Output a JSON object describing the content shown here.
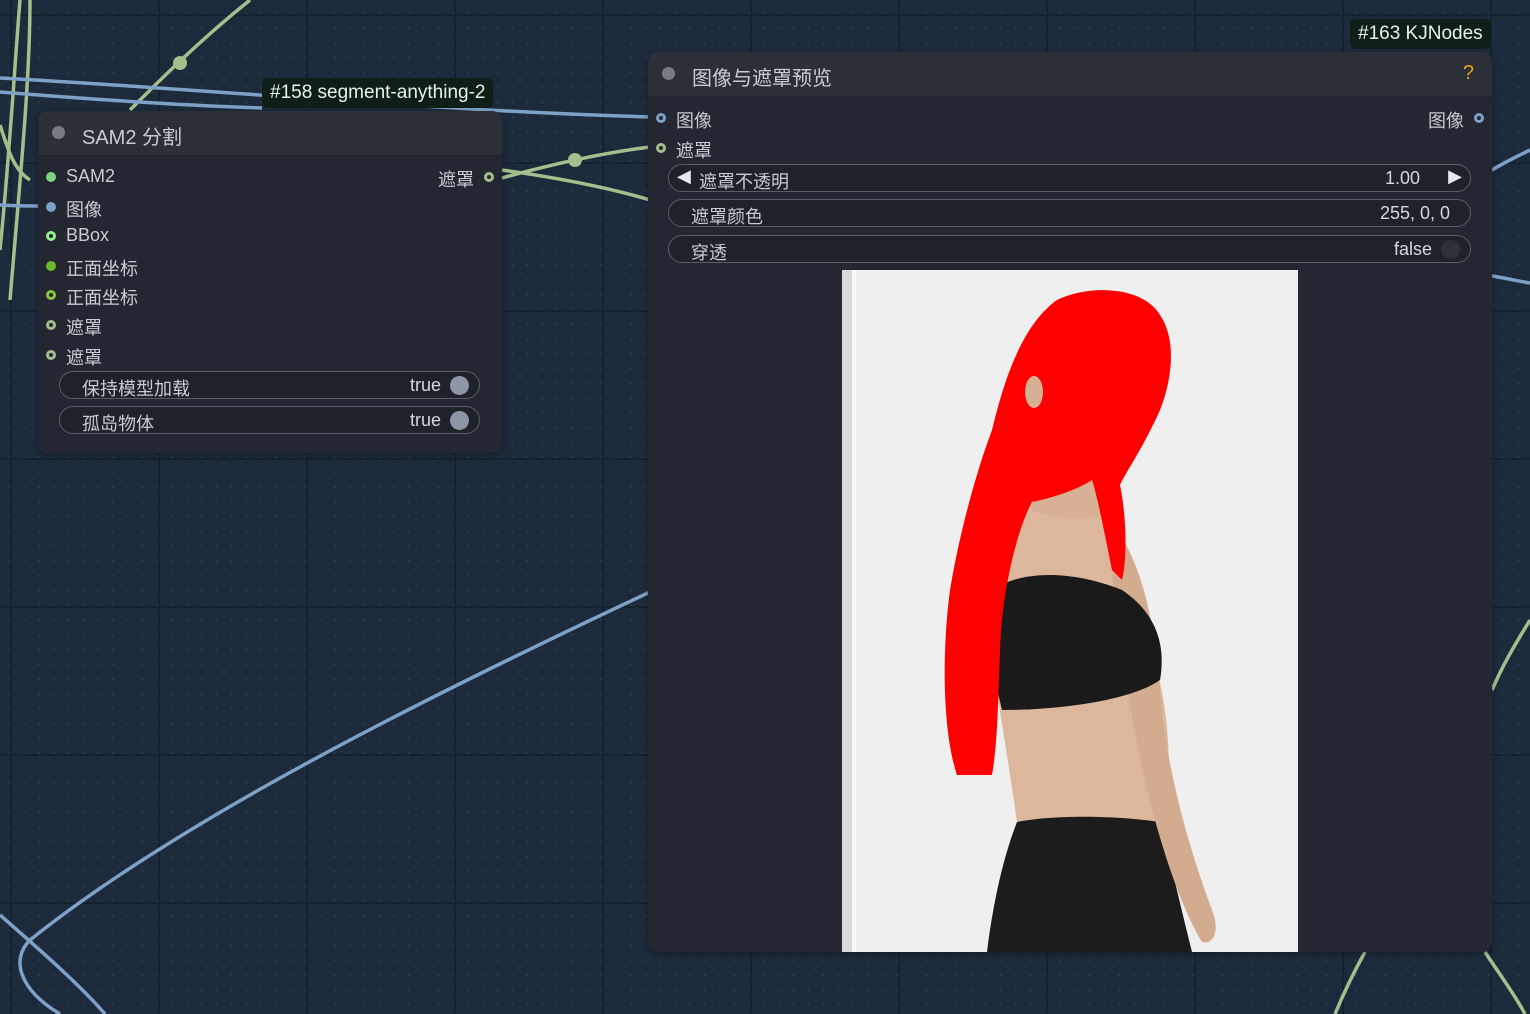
{
  "node_sam2": {
    "id_badge": "#158 segment-anything-2",
    "title": "SAM2 分割",
    "inputs": [
      {
        "label": "SAM2",
        "color": "#7bd67b",
        "hollow": false
      },
      {
        "label": "图像",
        "color": "#7da1c7",
        "hollow": false
      },
      {
        "label": "BBox",
        "color": "#8ff08f",
        "hollow": true
      },
      {
        "label": "正面坐标",
        "color": "#6bb82a",
        "hollow": false
      },
      {
        "label": "正面坐标",
        "color": "#8cc63e",
        "hollow": true
      },
      {
        "label": "遮罩",
        "color": "#a3bf8c",
        "hollow": true
      },
      {
        "label": "遮罩",
        "color": "#a3bf8c",
        "hollow": true
      }
    ],
    "output": {
      "label": "遮罩",
      "color": "#a3bf8c"
    },
    "widgets": [
      {
        "label": "保持模型加载",
        "value": "true"
      },
      {
        "label": "孤岛物体",
        "value": "true"
      }
    ]
  },
  "node_preview": {
    "id_badge": "#163 KJNodes",
    "title": "图像与遮罩预览",
    "help_icon": "?",
    "inputs": [
      {
        "label": "图像",
        "color": "#7da1c7"
      },
      {
        "label": "遮罩",
        "color": "#a3bf8c"
      }
    ],
    "output": {
      "label": "图像",
      "color": "#7da1c7"
    },
    "widgets": {
      "mask_opacity": {
        "label": "遮罩不透明",
        "value": "1.00"
      },
      "mask_color": {
        "label": "遮罩颜色",
        "value": "255, 0, 0"
      },
      "pass_through": {
        "label": "穿透",
        "value": "false"
      }
    },
    "preview_image": "person-with-red-hair-mask"
  },
  "colors": {
    "canvas_bg": "#1d2a3b",
    "node_bg": "#242731",
    "wire_image": "#7da1c7",
    "wire_mask": "#a3bf8c",
    "mask_red": "#ff0000",
    "help_icon": "#e8a317"
  }
}
